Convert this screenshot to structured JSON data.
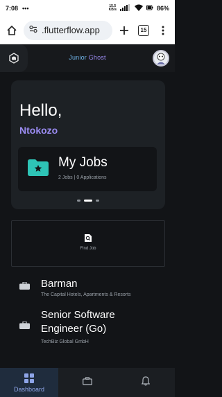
{
  "status_bar": {
    "time": "7:08",
    "notification_icon": "more-dots",
    "network_speed_top": "15.5",
    "network_speed_bottom": "KB/s",
    "battery": "86%"
  },
  "browser": {
    "url": ".flutterflow.app",
    "tab_count": "15"
  },
  "header": {
    "title_prefix": "Junior ",
    "title_accent": "Ghost"
  },
  "hero": {
    "greeting": "Hello,",
    "user_name": "Ntokozo",
    "my_jobs_title": "My Jobs",
    "my_jobs_summary": "2 Jobs | 0 Applications"
  },
  "find_job": {
    "label": "Find Job"
  },
  "jobs": [
    {
      "title": "Barman",
      "company": "The Capital Hotels, Apartments & Resorts"
    },
    {
      "title_line1": "Senior Software",
      "title_line2": "Engineer (Go)",
      "company": "TechBiz Global GmbH"
    }
  ],
  "bottom_nav": {
    "dashboard_label": "Dashboard"
  },
  "colors": {
    "background": "#121417",
    "card": "#1d2125",
    "accent_purple": "#9b8cf2",
    "accent_teal": "#2ec4b6"
  }
}
